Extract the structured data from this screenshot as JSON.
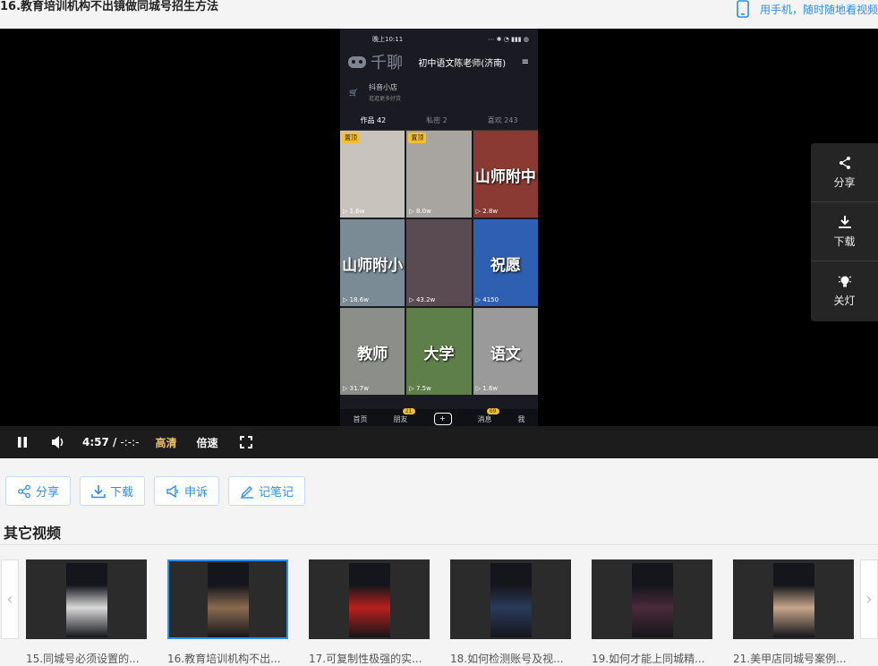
{
  "header": {
    "title": "16.教育培训机构不出镜做同城号招生方法",
    "mobile_link": "用手机，随时随地看视频"
  },
  "phone": {
    "status_time": "晚上10:11",
    "watermark": "千聊",
    "account_name": "初中语文陈老师(济南)",
    "shop_title": "抖音小店",
    "shop_sub": "逛逛更多好货",
    "tabs": [
      "作品 42",
      "私密 2",
      "喜欢 243"
    ],
    "cells": [
      {
        "pin": "置顶",
        "caption": "",
        "plays": "1.6w",
        "color": "#c9c3bd"
      },
      {
        "pin": "置顶",
        "caption": "",
        "plays": "8.0w",
        "color": "#a8a4a0"
      },
      {
        "pin": "",
        "caption": "山师附中",
        "plays": "2.8w",
        "color": "#8a3a32"
      },
      {
        "pin": "",
        "caption": "山师附小",
        "plays": "18.6w",
        "color": "#7b8b96"
      },
      {
        "pin": "",
        "caption": "",
        "plays": "43.2w",
        "color": "#5a4a52"
      },
      {
        "pin": "",
        "caption": "祝愿",
        "plays": "4150",
        "color": "#2f5fb0"
      },
      {
        "pin": "",
        "caption": "教师",
        "plays": "31.7w",
        "color": "#8c8e8a"
      },
      {
        "pin": "",
        "caption": "大学",
        "plays": "7.5w",
        "color": "#5e7f4a"
      },
      {
        "pin": "",
        "caption": "语文",
        "plays": "1.6w",
        "color": "#9a9a9a"
      }
    ],
    "nav": [
      "首页",
      "朋友",
      "+",
      "消息",
      "我"
    ],
    "friend_badge": "21",
    "msg_badge": "69"
  },
  "side_panel": {
    "share": "分享",
    "download": "下载",
    "light": "关灯"
  },
  "controls": {
    "current_time": "4:57",
    "separator": "/",
    "duration": "-:-:-",
    "quality": "高清",
    "speed": "倍速"
  },
  "actions": {
    "share": "分享",
    "download": "下载",
    "report": "申诉",
    "notes": "记笔记"
  },
  "other_videos": {
    "title": "其它视频",
    "items": [
      {
        "label": "15.同城号必须设置的...",
        "active": false,
        "tint": "#d9d9d9"
      },
      {
        "label": "16.教育培训机构不出...",
        "active": true,
        "tint": "#8a6a50"
      },
      {
        "label": "17.可复制性极强的实...",
        "active": false,
        "tint": "#b8201c"
      },
      {
        "label": "18.如何检测账号及视...",
        "active": false,
        "tint": "#2a3a5a"
      },
      {
        "label": "19.如何才能上同城精...",
        "active": false,
        "tint": "#4a2a3a"
      },
      {
        "label": "21.美甲店同城号案例...",
        "active": false,
        "tint": "#c7a58a"
      }
    ]
  },
  "colors": {
    "accent": "#2f8ef0",
    "quality": "#f0c264",
    "pin": "#f6c02b"
  }
}
